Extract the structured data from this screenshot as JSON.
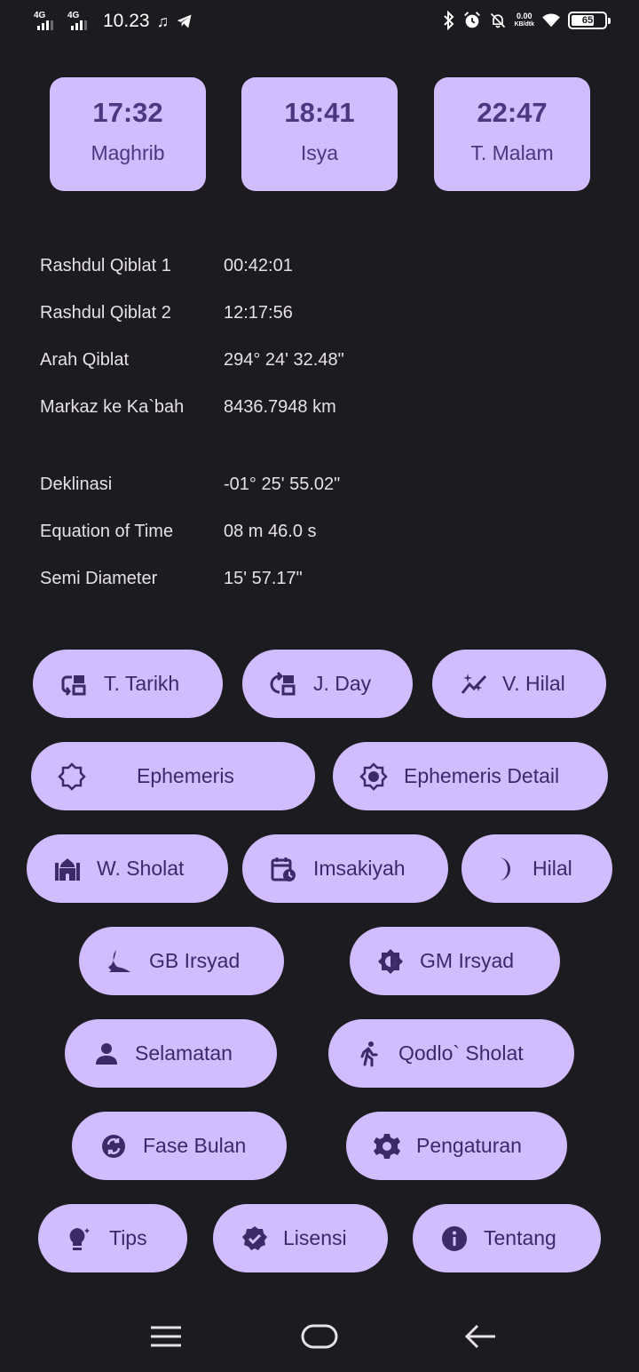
{
  "status_bar": {
    "signal1": "4G",
    "signal2": "4G",
    "time": "10.23",
    "net_speed": "0.00",
    "net_unit": "KB/dtk",
    "battery": "65"
  },
  "prayer_cards": [
    {
      "time": "17:32",
      "name": "Maghrib"
    },
    {
      "time": "18:41",
      "name": "Isya"
    },
    {
      "time": "22:47",
      "name": "T. Malam"
    }
  ],
  "info": [
    {
      "label": "Rashdul Qiblat 1",
      "value": "00:42:01"
    },
    {
      "label": "Rashdul Qiblat 2",
      "value": "12:17:56"
    },
    {
      "label": "Arah Qiblat",
      "value": "294° 24' 32.48\""
    },
    {
      "label": "Markaz ke Ka`bah",
      "value": "8436.7948 km"
    },
    {
      "label": "Deklinasi",
      "value": "-01° 25' 55.02\""
    },
    {
      "label": "Equation of Time",
      "value": "08 m 46.0 s"
    },
    {
      "label": "Semi Diameter",
      "value": "15' 57.17\""
    }
  ],
  "buttons": [
    {
      "label": "T. Tarikh",
      "icon": "date-convert-icon"
    },
    {
      "label": "J. Day",
      "icon": "date-refresh-icon"
    },
    {
      "label": "V. Hilal",
      "icon": "sparkle-chart-icon"
    },
    {
      "label": "Ephemeris",
      "icon": "sun-outline-icon"
    },
    {
      "label": "Ephemeris Detail",
      "icon": "sun-detail-icon"
    },
    {
      "label": "W. Sholat",
      "icon": "mosque-icon"
    },
    {
      "label": "Imsakiyah",
      "icon": "calendar-clock-icon"
    },
    {
      "label": "Hilal",
      "icon": "crescent-icon"
    },
    {
      "label": "GB Irsyad",
      "icon": "moon-eclipse-icon"
    },
    {
      "label": "GM Irsyad",
      "icon": "sun-eclipse-icon"
    },
    {
      "label": "Selamatan",
      "icon": "person-icon"
    },
    {
      "label": "Qodlo` Sholat",
      "icon": "walking-icon"
    },
    {
      "label": "Fase Bulan",
      "icon": "moon-phase-icon"
    },
    {
      "label": "Pengaturan",
      "icon": "gear-icon"
    },
    {
      "label": "Tips",
      "icon": "lightbulb-icon"
    },
    {
      "label": "Lisensi",
      "icon": "verified-icon"
    },
    {
      "label": "Tentang",
      "icon": "info-icon"
    }
  ],
  "colors": {
    "background": "#1c1b1f",
    "accent": "#d0bcff",
    "on_accent": "#3b2a66"
  }
}
